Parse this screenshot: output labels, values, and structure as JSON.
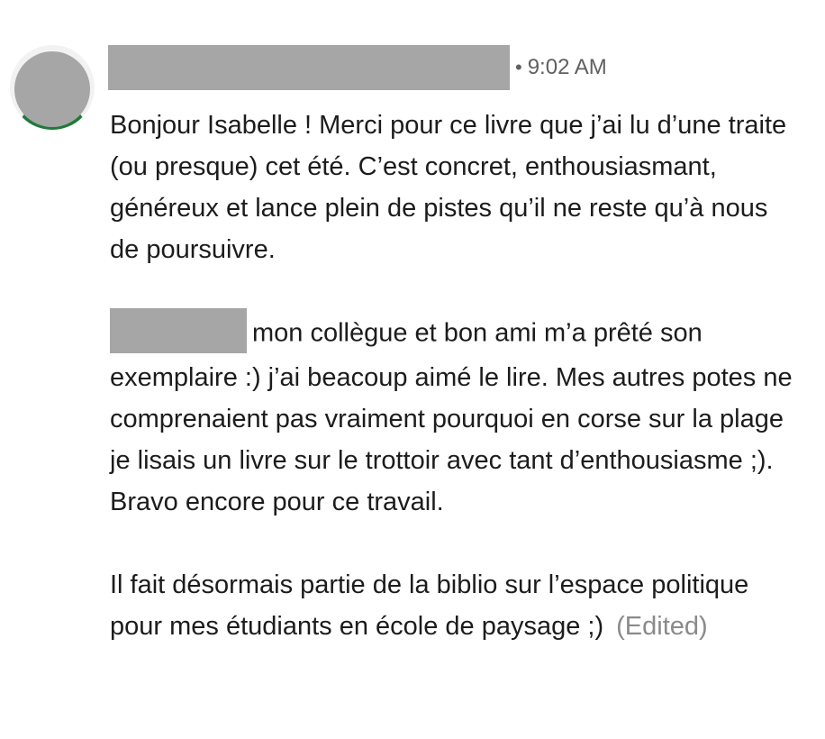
{
  "message": {
    "avatar_icon": "user-avatar",
    "author_redacted": true,
    "timestamp_separator": "•",
    "timestamp": "9:02 AM",
    "paragraph1": "Bonjour Isabelle ! Merci pour ce livre que j’ai lu d’une traite (ou presque) cet été. C’est concret, enthousiasmant, généreux et lance plein de pistes qu’il ne reste qu’à nous de poursuivre.",
    "paragraph2_after_mention": "mon collègue et bon ami m’a prêté son exemplaire :) j’ai beacoup aimé le lire. Mes autres potes ne comprenaient pas vraiment pourquoi en corse sur la plage je lisais un livre sur le trottoir avec tant d’enthousiasme ;).",
    "paragraph2_line2": "Bravo encore pour ce travail.",
    "paragraph3": "Il fait désormais partie de la biblio sur l’espace politique pour mes étudiants en école de paysage ;)",
    "edited_label": "(Edited)"
  },
  "colors": {
    "text": "#1d1c1d",
    "muted": "#616061",
    "edited": "#8b8a8b",
    "redaction": "#a6a6a6",
    "avatar_shirt": "#1f7a3a"
  }
}
